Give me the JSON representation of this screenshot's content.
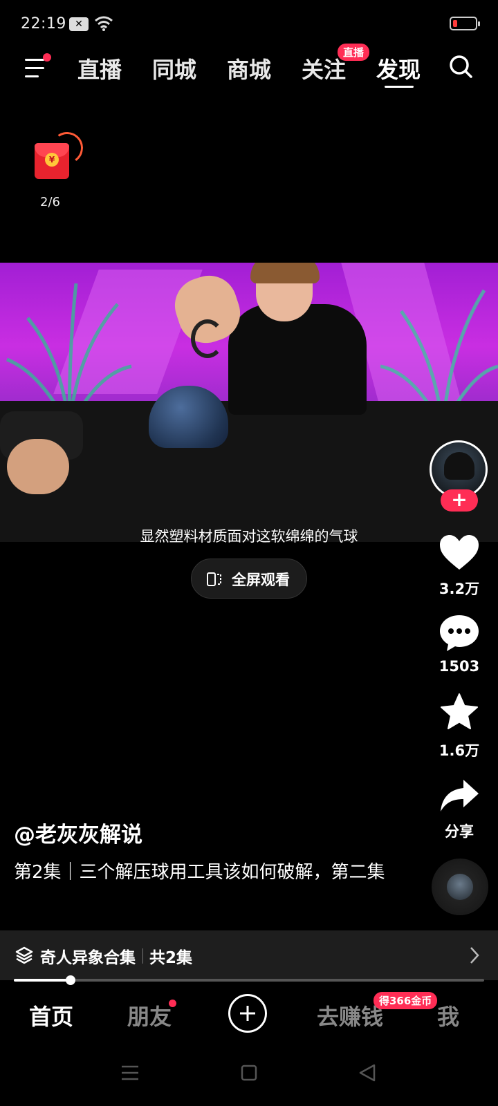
{
  "status_bar": {
    "time": "22:19",
    "notification_icon": "close-icon",
    "battery_color": "#ff3b3b"
  },
  "top_nav": {
    "tabs": [
      "直播",
      "同城",
      "商城",
      "关注",
      "发现"
    ],
    "active_tab": "发现",
    "follow_badge": "直播"
  },
  "red_packet": {
    "count": "2/6"
  },
  "video": {
    "subtitle": "显然塑料材质面对这软绵绵的气球"
  },
  "fullscreen": {
    "label": "全屏观看"
  },
  "actions": {
    "likes": "3.2万",
    "comments": "1503",
    "favorites": "1.6万",
    "share": "分享"
  },
  "caption": {
    "author": "@老灰灰解说",
    "description": "第2集｜三个解压球用工具该如何破解，第二集"
  },
  "collection": {
    "title": "奇人异象合集",
    "count": "共2集"
  },
  "progress": {
    "fraction": 0.12
  },
  "bottom_nav": {
    "items": [
      "首页",
      "朋友",
      "去赚钱",
      "我"
    ],
    "active": "首页",
    "earn_badge": "得366金币"
  },
  "colors": {
    "accent": "#ff2d55",
    "background": "#000000"
  }
}
